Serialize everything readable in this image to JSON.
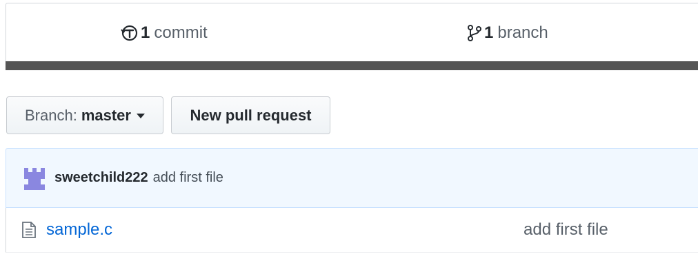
{
  "summary": {
    "commits": {
      "count": "1",
      "label": "commit",
      "icon": "history-icon"
    },
    "branches": {
      "count": "1",
      "label": "branch",
      "icon": "git-branch-icon"
    }
  },
  "language_bar_color": "#555555",
  "toolbar": {
    "branch_label": "Branch:",
    "branch_value": "master",
    "new_pr_label": "New pull request"
  },
  "commit_tease": {
    "author": "sweetchild222",
    "message": "add first file",
    "avatar_color": "#8a87e0"
  },
  "files": [
    {
      "name": "sample.c",
      "message": "add first file",
      "icon": "file-icon"
    }
  ],
  "colors": {
    "link": "#0366d6",
    "tease_bg": "#f1f8ff",
    "tease_border": "#c8e1ff"
  }
}
